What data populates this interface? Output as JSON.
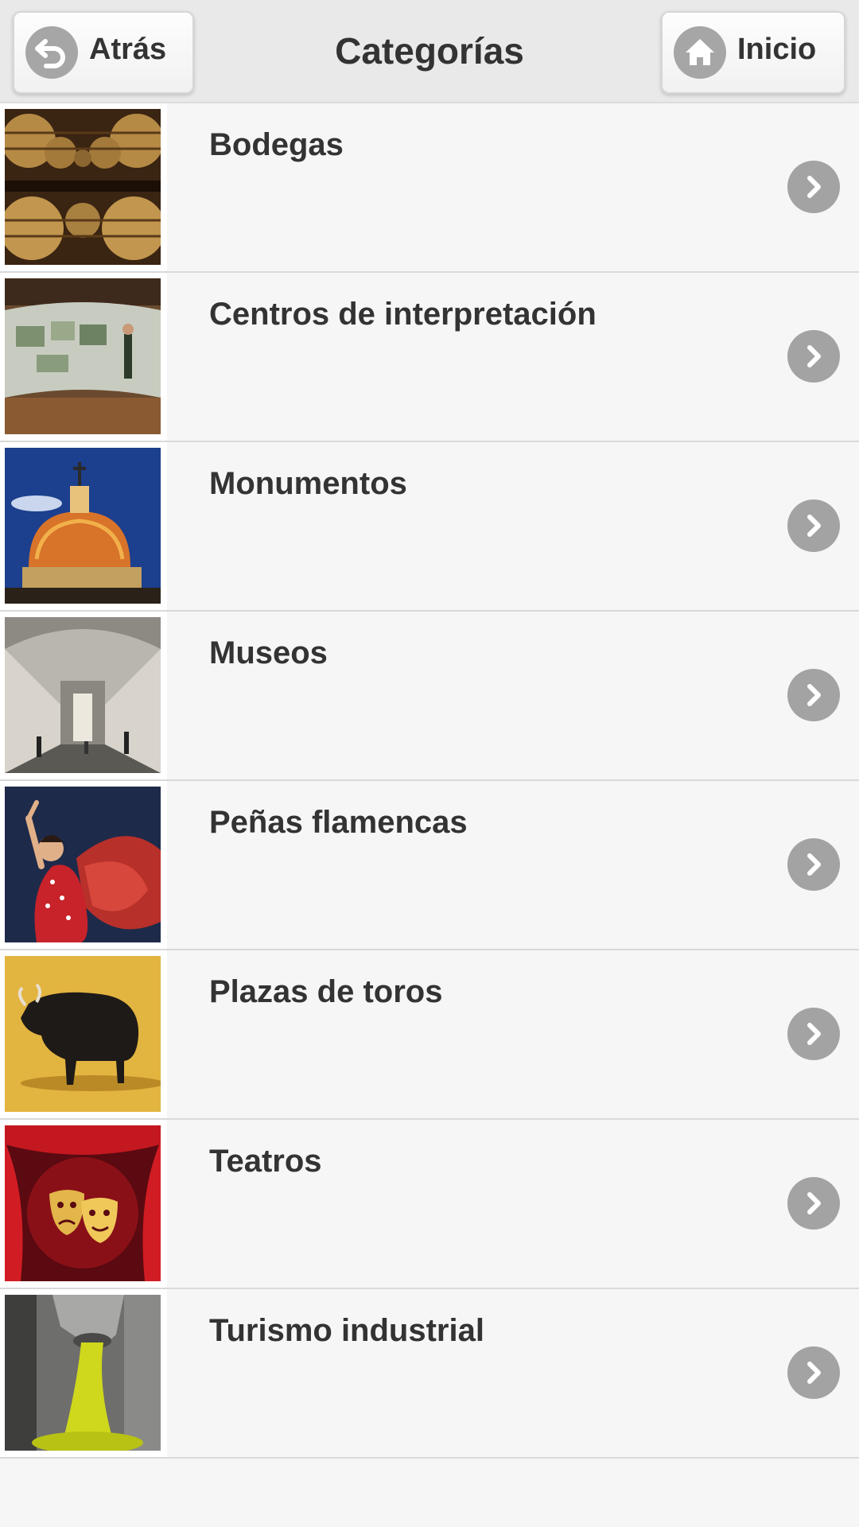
{
  "header": {
    "title": "Categorías",
    "back_label": "Atrás",
    "home_label": "Inicio"
  },
  "categories": [
    {
      "label": "Bodegas",
      "icon": "wine-barrels-thumbnail"
    },
    {
      "label": "Centros de interpretación",
      "icon": "exhibition-hall-thumbnail"
    },
    {
      "label": "Monumentos",
      "icon": "church-dome-thumbnail"
    },
    {
      "label": "Museos",
      "icon": "museum-gallery-thumbnail"
    },
    {
      "label": "Peñas flamencas",
      "icon": "flamenco-dancer-thumbnail"
    },
    {
      "label": "Plazas de toros",
      "icon": "bull-thumbnail"
    },
    {
      "label": "Teatros",
      "icon": "theatre-masks-thumbnail"
    },
    {
      "label": "Turismo industrial",
      "icon": "olive-oil-thumbnail"
    }
  ],
  "colors": {
    "background": "#f6f6f6",
    "header": "#e9e9e9",
    "icon_gray": "#a3a3a3",
    "text": "#333333"
  }
}
